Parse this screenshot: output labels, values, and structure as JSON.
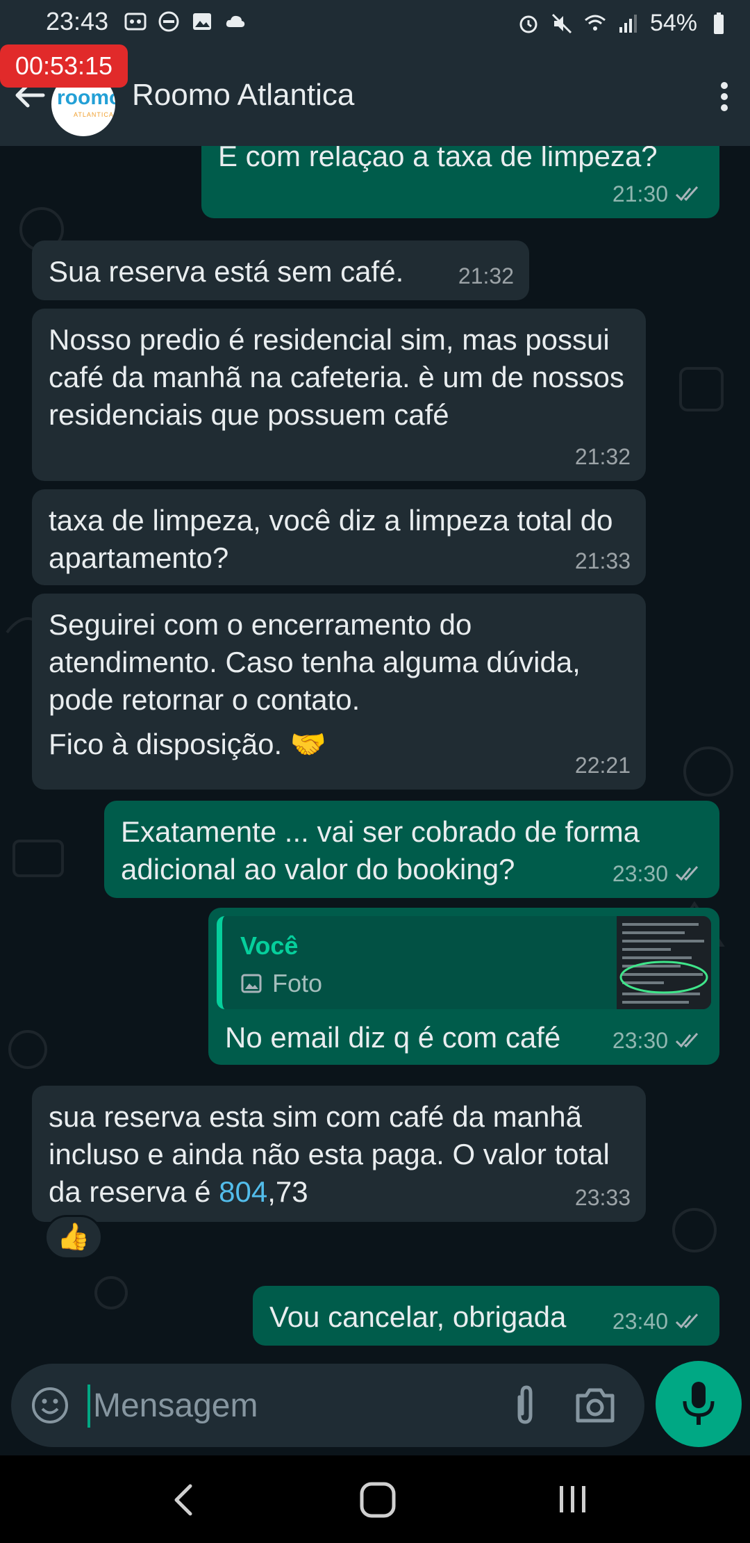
{
  "status_bar": {
    "time": "23:43",
    "battery": "54%"
  },
  "timer": "00:53:15",
  "header": {
    "contact_name": "Roomo Atlantica",
    "avatar_text": "roomo",
    "avatar_subtext": "ATLANTICA"
  },
  "messages": [
    {
      "dir": "out",
      "text": "E com relaçao  a taxa de limpeza?",
      "time": "21:30",
      "read": true
    },
    {
      "dir": "in",
      "text": "Sua reserva está sem café.",
      "time": "21:32"
    },
    {
      "dir": "in",
      "text": "Nosso predio é residencial sim, mas possui café da manhã na cafeteria. è um de nossos residenciais que possuem café",
      "time": "21:32"
    },
    {
      "dir": "in",
      "text": "taxa de limpeza, você diz a limpeza total do apartamento?",
      "time": "21:33"
    },
    {
      "dir": "in",
      "text": "Seguirei com o encerramento do atendimento. Caso tenha alguma dúvida, pode retornar o contato.",
      "text2": "Fico à disposição. 🤝",
      "time": "22:21"
    },
    {
      "dir": "out",
      "text": "Exatamente ... vai ser cobrado  de forma adicional ao valor do booking?",
      "time": "23:30",
      "read": true
    },
    {
      "dir": "out",
      "quote_author": "Você",
      "quote_type": "Foto",
      "text": "No email diz q é com café",
      "time": "23:30",
      "read": true
    },
    {
      "dir": "in",
      "text_before_link": "sua reserva esta sim com café da manhã incluso e ainda não esta paga. O valor total da reserva é ",
      "link": "804",
      "text_after_link": ",73",
      "time": "23:33",
      "reaction": "👍"
    },
    {
      "dir": "out",
      "text": "Vou cancelar, obrigada",
      "time": "23:40",
      "read": true
    }
  ],
  "input": {
    "placeholder": "Mensagem"
  },
  "colors": {
    "incoming": "#202c33",
    "outgoing": "#005c4b",
    "accent": "#00a884",
    "link": "#53bdeb"
  }
}
